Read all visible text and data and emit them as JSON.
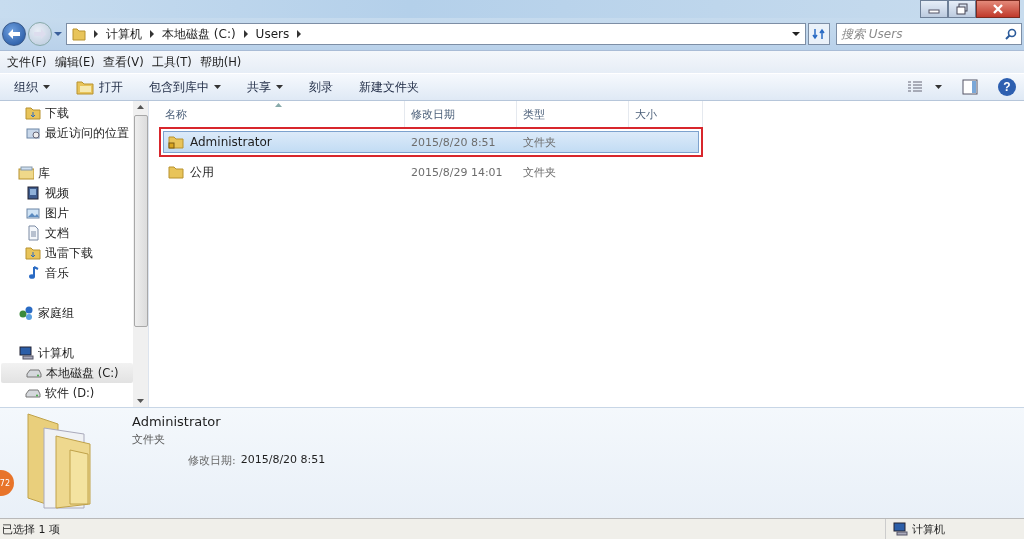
{
  "address": {
    "crumbs": [
      "计算机",
      "本地磁盘 (C:)",
      "Users"
    ],
    "search_placeholder": "搜索 Users"
  },
  "menu": [
    "文件(F)",
    "编辑(E)",
    "查看(V)",
    "工具(T)",
    "帮助(H)"
  ],
  "toolbar": [
    {
      "label": "组织",
      "dropdown": true,
      "kind": "plain"
    },
    {
      "label": "打开",
      "dropdown": false,
      "kind": "open"
    },
    {
      "label": "包含到库中",
      "dropdown": true,
      "kind": "plain"
    },
    {
      "label": "共享",
      "dropdown": true,
      "kind": "plain"
    },
    {
      "label": "刻录",
      "dropdown": false,
      "kind": "plain"
    },
    {
      "label": "新建文件夹",
      "dropdown": false,
      "kind": "plain"
    }
  ],
  "nav": [
    {
      "children": [
        {
          "label": "下载",
          "kind": "download",
          "selected": false
        },
        {
          "label": "最近访问的位置",
          "kind": "recent",
          "selected": false
        }
      ]
    },
    {
      "label": "库",
      "kind": "library",
      "selected": false,
      "children": [
        {
          "label": "视频",
          "kind": "video",
          "selected": false
        },
        {
          "label": "图片",
          "kind": "picture",
          "selected": false
        },
        {
          "label": "文档",
          "kind": "document",
          "selected": false
        },
        {
          "label": "迅雷下载",
          "kind": "download",
          "selected": false
        },
        {
          "label": "音乐",
          "kind": "music",
          "selected": false
        }
      ]
    },
    {
      "label": "家庭组",
      "kind": "homegroup",
      "selected": false
    },
    {
      "label": "计算机",
      "kind": "computer",
      "selected": false,
      "children": [
        {
          "label": "本地磁盘 (C:)",
          "kind": "drive",
          "selected": true
        },
        {
          "label": "软件 (D:)",
          "kind": "drive",
          "selected": false
        }
      ]
    }
  ],
  "table": {
    "columns": [
      "名称",
      "修改日期",
      "类型",
      "大小"
    ],
    "rows": [
      {
        "name": "Administrator",
        "modified": "2015/8/20 8:51",
        "type": "文件夹",
        "selected": true,
        "locked": true,
        "marked": true
      },
      {
        "name": "公用",
        "modified": "2015/8/29 14:01",
        "type": "文件夹",
        "selected": false,
        "locked": false,
        "marked": false
      }
    ]
  },
  "details": {
    "name": "Administrator",
    "type": "文件夹",
    "modified_label": "修改日期:",
    "modified_value": "2015/8/20 8:51"
  },
  "help": "?",
  "overlay_badge": "72",
  "status_bar": {
    "selection": "已选择 1 项",
    "location": "计算机"
  }
}
